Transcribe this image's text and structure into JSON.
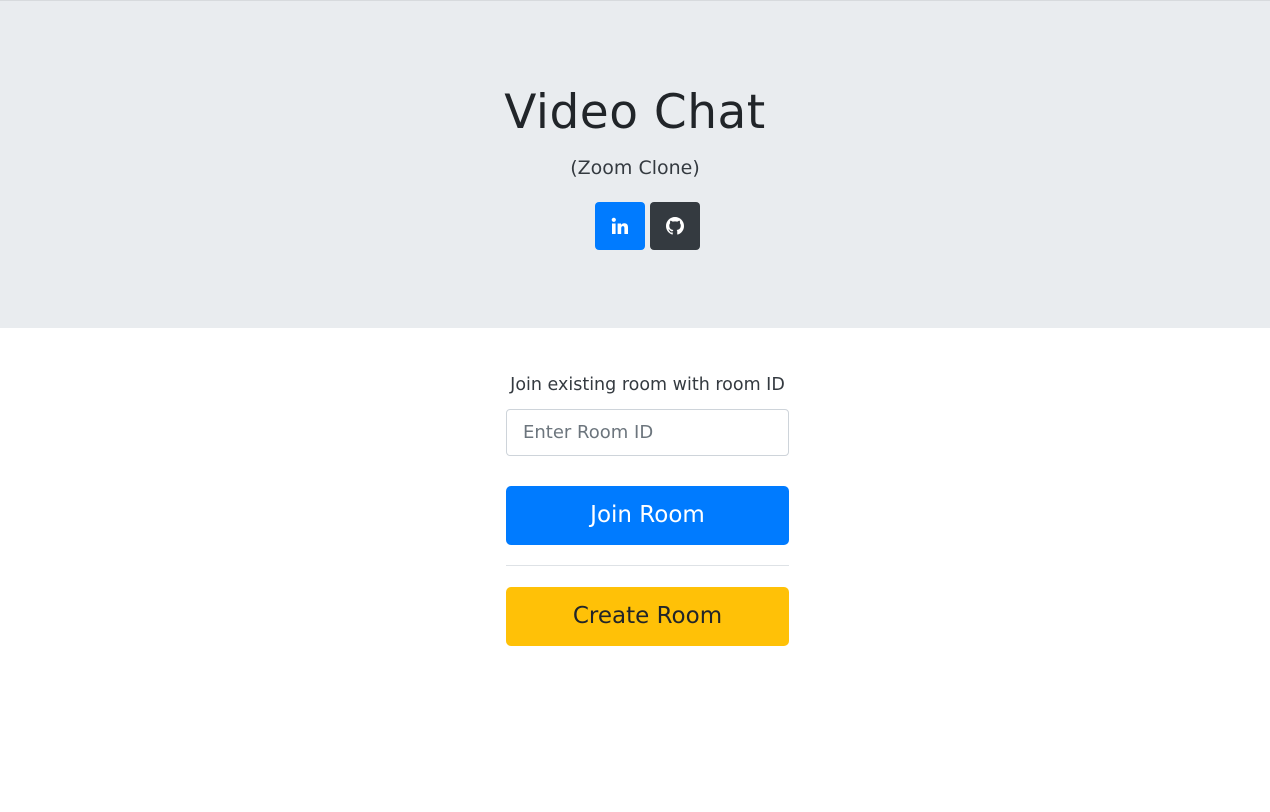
{
  "header": {
    "title": "Video Chat",
    "subtitle": "(Zoom Clone)",
    "social": [
      {
        "name": "linkedin",
        "icon": "linkedin-icon",
        "color": "#007bff"
      },
      {
        "name": "github",
        "icon": "github-icon",
        "color": "#343a40"
      }
    ]
  },
  "join": {
    "label": "Join existing room with room ID",
    "input_placeholder": "Enter Room ID",
    "input_value": "",
    "button_label": "Join Room",
    "button_color": "#007bff"
  },
  "create": {
    "button_label": "Create Room",
    "button_color": "#ffc107"
  },
  "colors": {
    "header_background": "#e9ecef"
  }
}
